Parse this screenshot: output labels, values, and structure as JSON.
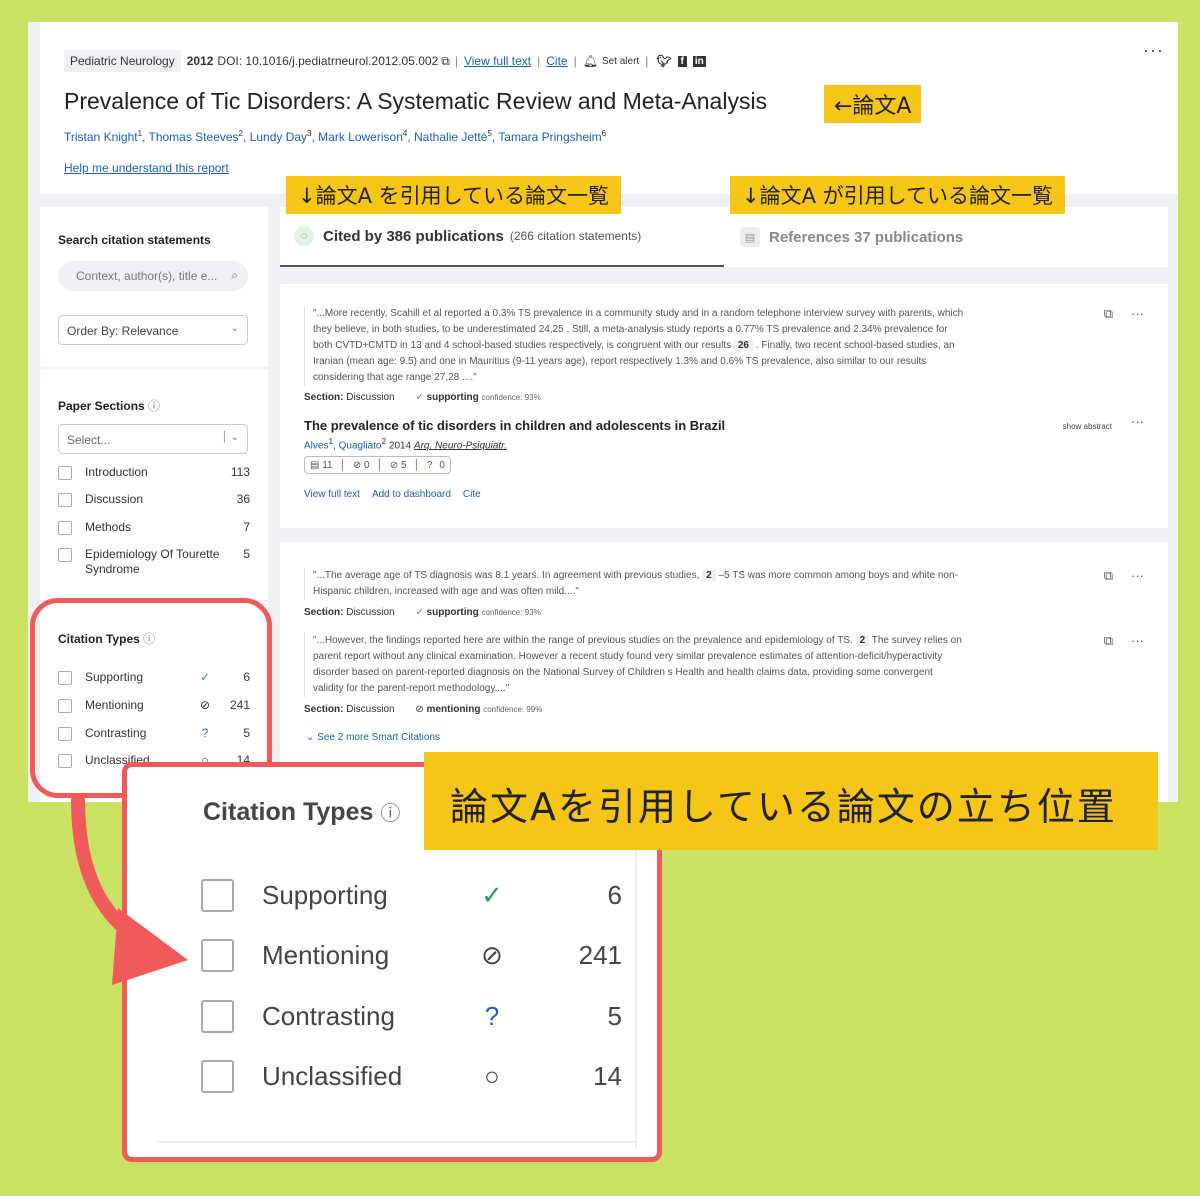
{
  "header": {
    "journal": "Pediatric Neurology",
    "year": "2012",
    "doi": "DOI: 10.1016/j.pediatrneurol.2012.05.002",
    "view_full_text": "View full text",
    "cite": "Cite",
    "set_alert": "Set alert",
    "title": "Prevalence of Tic Disorders: A Systematic Review and Meta-Analysis",
    "authors": [
      {
        "name": "Tristan Knight",
        "sup": "1"
      },
      {
        "name": "Thomas Steeves",
        "sup": "2"
      },
      {
        "name": "Lundy Day",
        "sup": "3"
      },
      {
        "name": "Mark Lowerison",
        "sup": "4"
      },
      {
        "name": "Nathalie Jetté",
        "sup": "5"
      },
      {
        "name": "Tamara Pringsheim",
        "sup": "6"
      }
    ],
    "help_link": "Help me understand this report",
    "more": "···"
  },
  "sidebar": {
    "search_heading": "Search citation statements",
    "search_placeholder": "Context, author(s), title e...",
    "order_by": "Order By: Relevance",
    "paper_sections_heading": "Paper Sections",
    "sections_select_placeholder": "Select...",
    "sections": [
      {
        "label": "Introduction",
        "count": "113"
      },
      {
        "label": "Discussion",
        "count": "36"
      },
      {
        "label": "Methods",
        "count": "7"
      },
      {
        "label": "Epidemiology Of Tourette Syndrome",
        "count": "5"
      }
    ],
    "citation_types_heading": "Citation Types",
    "citation_types": [
      {
        "label": "Supporting",
        "count": "6",
        "icon": "check-circle-icon",
        "color": "#2e9e52"
      },
      {
        "label": "Mentioning",
        "count": "241",
        "icon": "mention-circle-icon",
        "color": "#555555"
      },
      {
        "label": "Contrasting",
        "count": "5",
        "icon": "question-circle-icon",
        "color": "#1a5fd4"
      },
      {
        "label": "Unclassified",
        "count": "14",
        "icon": "empty-circle-icon",
        "color": "#555555"
      }
    ]
  },
  "tabs": {
    "cited_by": "Cited by 386 publications",
    "cited_by_sub": "(266 citation statements)",
    "references": "References 37 publications"
  },
  "cards": [
    {
      "quotes": [
        {
          "text_before": "\"...More recently, Scahill et al reported a 0.3% TS prevalence in a community study and in a random telephone interview survey with parents, which they believe, in both studies, to be underestimated 24,25 . Still, a meta-analysis study reports a 0.77% TS prevalence and 2.34% prevalence for both CVTD+CMTD in 13 and 4 school-based studies respectively, is congruent with our results",
          "ref": "26",
          "text_after": ". Finally, two recent school-based studies, an Iranian (mean age: 9.5) and one in Mauritius (9-11 years age), report respectively 1.3% and 0.6% TS prevalence, also similar to our results considering that age range 27,28 ....\"",
          "section_label": "Section:",
          "section": "Discussion",
          "type": "supporting",
          "confidence": "confidence: 93%"
        }
      ],
      "paper_title": "The prevalence of tic disorders in children and adolescents in Brazil",
      "authors": [
        {
          "name": "Alves",
          "sup": "1"
        },
        {
          "name": "Quagliato",
          "sup": "2"
        }
      ],
      "year": "2014",
      "journal": "Arq. Neuro-Psiquiatr.",
      "show_abstract": "show abstract",
      "counts": [
        "11",
        "0",
        "5",
        "0"
      ],
      "links": [
        "View full text",
        "Add to dashboard",
        "Cite"
      ]
    },
    {
      "quotes": [
        {
          "text_before": "\"...The average age of TS diagnosis was 8.1 years. In agreement with previous studies,",
          "ref": "2",
          "text_after": "–5 TS was more common among boys and white non-Hispanic children, increased with age and was often mild....\"",
          "section_label": "Section:",
          "section": "Discussion",
          "type": "supporting",
          "confidence": "confidence: 93%"
        },
        {
          "text_before": "\"...However, the findings reported here are within the range of previous studies on the prevalence and epidemiology of TS.",
          "ref": "2",
          "text_after": "The survey relies on parent report without any clinical examination. However a recent study found very similar prevalence estimates of attention-deficit/hyperactivity disorder based on parent-reported diagnosis on the National Survey of Children s Health and health claims data, providing some convergent validity for the parent-report methodology....\"",
          "section_label": "Section:",
          "section": "Discussion",
          "type": "mentioning",
          "confidence": "confidence: 99%"
        }
      ],
      "see_more": "See 2 more Smart Citations"
    }
  ],
  "annotations": {
    "paper_a": "←論文A",
    "cited_by_note": "↓論文A を引用している論文一覧",
    "references_note": "↓論文A が引用している論文一覧",
    "position_note": "論文Aを引用している論文の立ち位置",
    "highlight_color": "#f5c518",
    "callout_color": "#f05a5a"
  },
  "zoom": {
    "heading": "Citation Types"
  }
}
